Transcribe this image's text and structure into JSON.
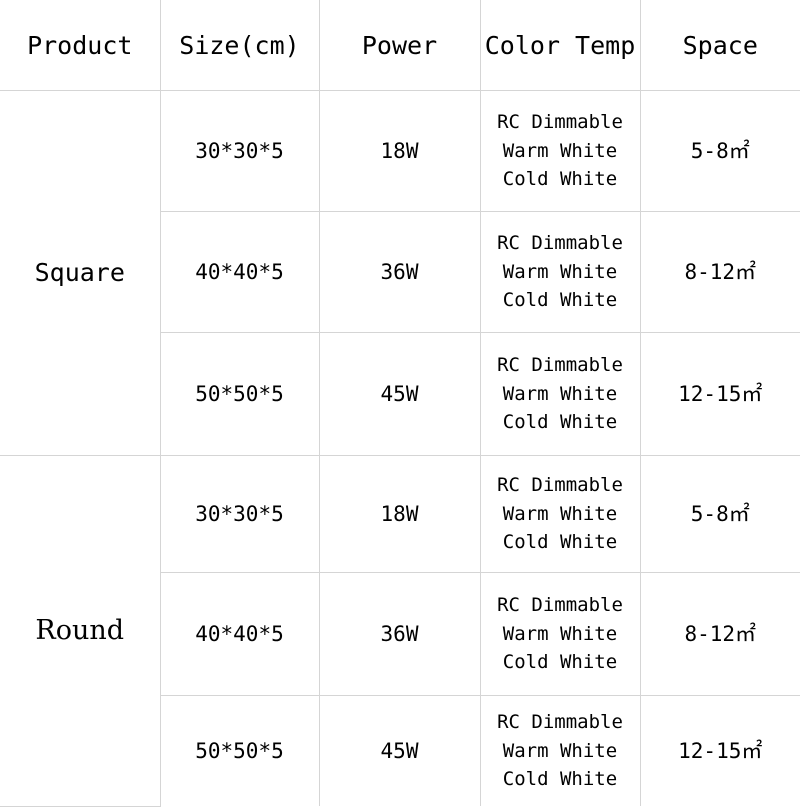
{
  "table": {
    "headers": [
      {
        "label": "Product",
        "name": "column-header-product"
      },
      {
        "label": "Size(cm)",
        "name": "column-header-size"
      },
      {
        "label": "Power",
        "name": "column-header-power"
      },
      {
        "label": "Color Temp",
        "name": "column-header-color-temp"
      },
      {
        "label": "Space",
        "name": "column-header-space"
      }
    ],
    "groups": [
      {
        "product": "Square",
        "rows": [
          {
            "size": "30*30*5",
            "power": "18W",
            "color_temp": "RC Dimmable\nWarm White\nCold White",
            "space": "5-8㎡"
          },
          {
            "size": "40*40*5",
            "power": "36W",
            "color_temp": "RC Dimmable\nWarm White\nCold White",
            "space": "8-12㎡"
          },
          {
            "size": "50*50*5",
            "power": "45W",
            "color_temp": "RC Dimmable\nWarm White\nCold White",
            "space": "12-15㎡"
          }
        ]
      },
      {
        "product": "Round",
        "rows": [
          {
            "size": "30*30*5",
            "power": "18W",
            "color_temp": "RC Dimmable\nWarm White\nCold White",
            "space": "5-8㎡"
          },
          {
            "size": "40*40*5",
            "power": "36W",
            "color_temp": "RC Dimmable\nWarm White\nCold White",
            "space": "8-12㎡"
          },
          {
            "size": "50*50*5",
            "power": "45W",
            "color_temp": "RC Dimmable\nWarm White\nCold White",
            "space": "12-15㎡"
          }
        ]
      }
    ],
    "colors": {
      "border": "#d5d5d5",
      "text": "#000000",
      "background": "#ffffff"
    }
  }
}
